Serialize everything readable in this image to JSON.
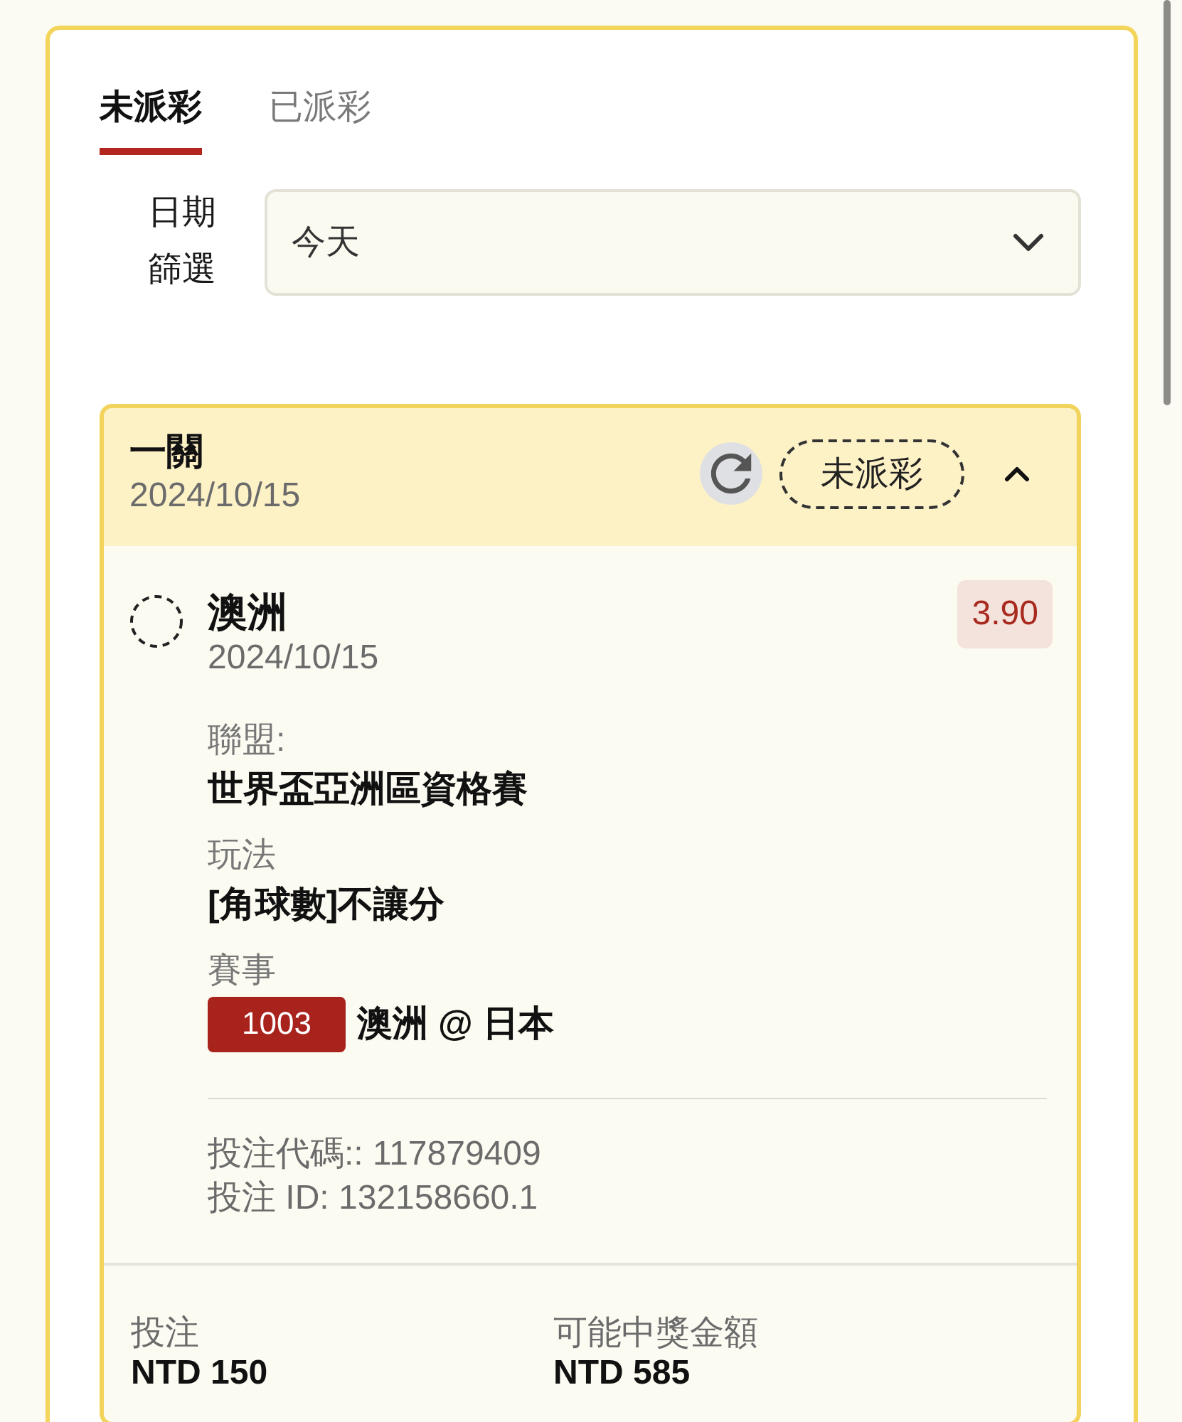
{
  "tabs": [
    {
      "label": "未派彩",
      "selected": true
    },
    {
      "label": "已派彩",
      "selected": false
    }
  ],
  "date_filter": {
    "label": "日期篩選",
    "value": "今天"
  },
  "bet": {
    "type": "一關",
    "date": "2024/10/15",
    "status": "未派彩",
    "expanded": true,
    "selection": {
      "name": "澳洲",
      "date": "2024/10/15",
      "odds": "3.90"
    },
    "details": [
      {
        "kind": "text",
        "label": "聯盟:",
        "value": "世界盃亞洲區資格賽"
      },
      {
        "kind": "text",
        "label": "玩法",
        "value": "[角球數]不讓分"
      },
      {
        "kind": "match",
        "label": "賽事",
        "code": "1003",
        "value": "澳洲 @ 日本"
      }
    ],
    "references": [
      "投注代碼:: 117879409",
      "投注 ID: 132158660.1"
    ],
    "summary": [
      {
        "label": "投注",
        "value": "NTD 150"
      },
      {
        "label": "可能中獎金額",
        "value": "NTD 585"
      }
    ]
  }
}
